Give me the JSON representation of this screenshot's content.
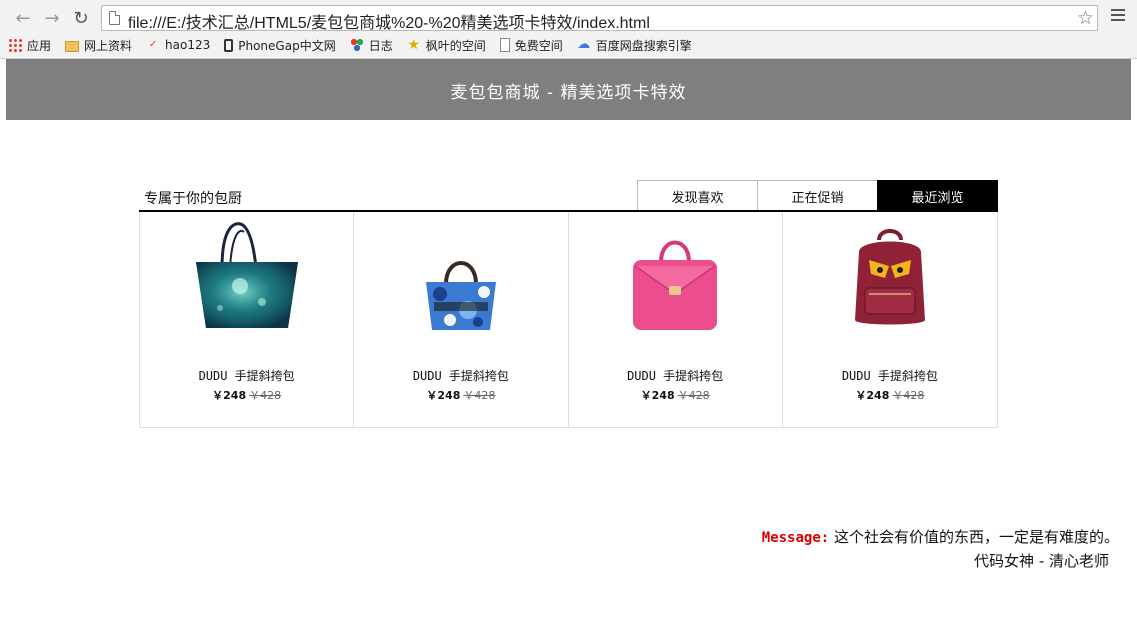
{
  "browser": {
    "url": "file:///E:/技术汇总/HTML5/麦包包商城%20-%20精美选项卡特效/index.html",
    "bookmarks": [
      {
        "label": "应用",
        "icon": "apps-grid-icon"
      },
      {
        "label": "网上资料",
        "icon": "folder-icon"
      },
      {
        "label": "hao123",
        "icon": "hao123-icon"
      },
      {
        "label": "PhoneGap中文网",
        "icon": "phone-icon"
      },
      {
        "label": "日志",
        "icon": "circles-icon"
      },
      {
        "label": "枫叶的空间",
        "icon": "star-icon"
      },
      {
        "label": "免费空间",
        "icon": "page-icon"
      },
      {
        "label": "百度网盘搜索引擎",
        "icon": "cloud-icon"
      }
    ]
  },
  "banner": {
    "title": "麦包包商城 - 精美选项卡特效"
  },
  "section": {
    "heading": "专属于你的包厨",
    "tabs": [
      {
        "label": "发现喜欢",
        "active": false
      },
      {
        "label": "正在促销",
        "active": false
      },
      {
        "label": "最近浏览",
        "active": true
      }
    ]
  },
  "products": [
    {
      "name": "DUDU 手提斜挎包",
      "price": "￥248",
      "old_price": "￥428",
      "image": "teal-tote-bag"
    },
    {
      "name": "DUDU 手提斜挎包",
      "price": "￥248",
      "old_price": "￥428",
      "image": "camo-handbag"
    },
    {
      "name": "DUDU 手提斜挎包",
      "price": "￥248",
      "old_price": "￥428",
      "image": "pink-satchel"
    },
    {
      "name": "DUDU 手提斜挎包",
      "price": "￥248",
      "old_price": "￥428",
      "image": "red-monster-backpack"
    }
  ],
  "footer": {
    "label": "Message:",
    "text": "这个社会有价值的东西，一定是有难度的。",
    "signature": "代码女神 - 清心老师"
  },
  "colors": {
    "banner_bg": "#7f7f7f",
    "active_tab": "#000000",
    "message_label": "#dd0000"
  }
}
